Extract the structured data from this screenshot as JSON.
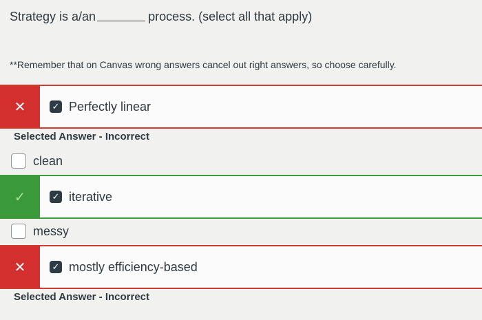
{
  "question": {
    "before_blank": "Strategy is a/an",
    "after_blank": "process. (select all that apply)"
  },
  "note": "**Remember that on Canvas wrong answers cancel out right answers, so choose carefully.",
  "answers": [
    {
      "label": "Perfectly linear",
      "selected": true,
      "result": "incorrect",
      "mark": "✕",
      "check": "✓",
      "feedback": "Selected Answer - Incorrect"
    },
    {
      "label": "clean",
      "selected": false
    },
    {
      "label": "iterative",
      "selected": true,
      "result": "correct",
      "mark": "✓",
      "check": "✓"
    },
    {
      "label": "messy",
      "selected": false
    },
    {
      "label": "mostly efficiency-based",
      "selected": true,
      "result": "incorrect",
      "mark": "✕",
      "check": "✓",
      "feedback": "Selected Answer - Incorrect"
    }
  ],
  "colors": {
    "incorrect": "#d32f2f",
    "correct": "#3a9a3a",
    "checkbox": "#2d3b45"
  }
}
